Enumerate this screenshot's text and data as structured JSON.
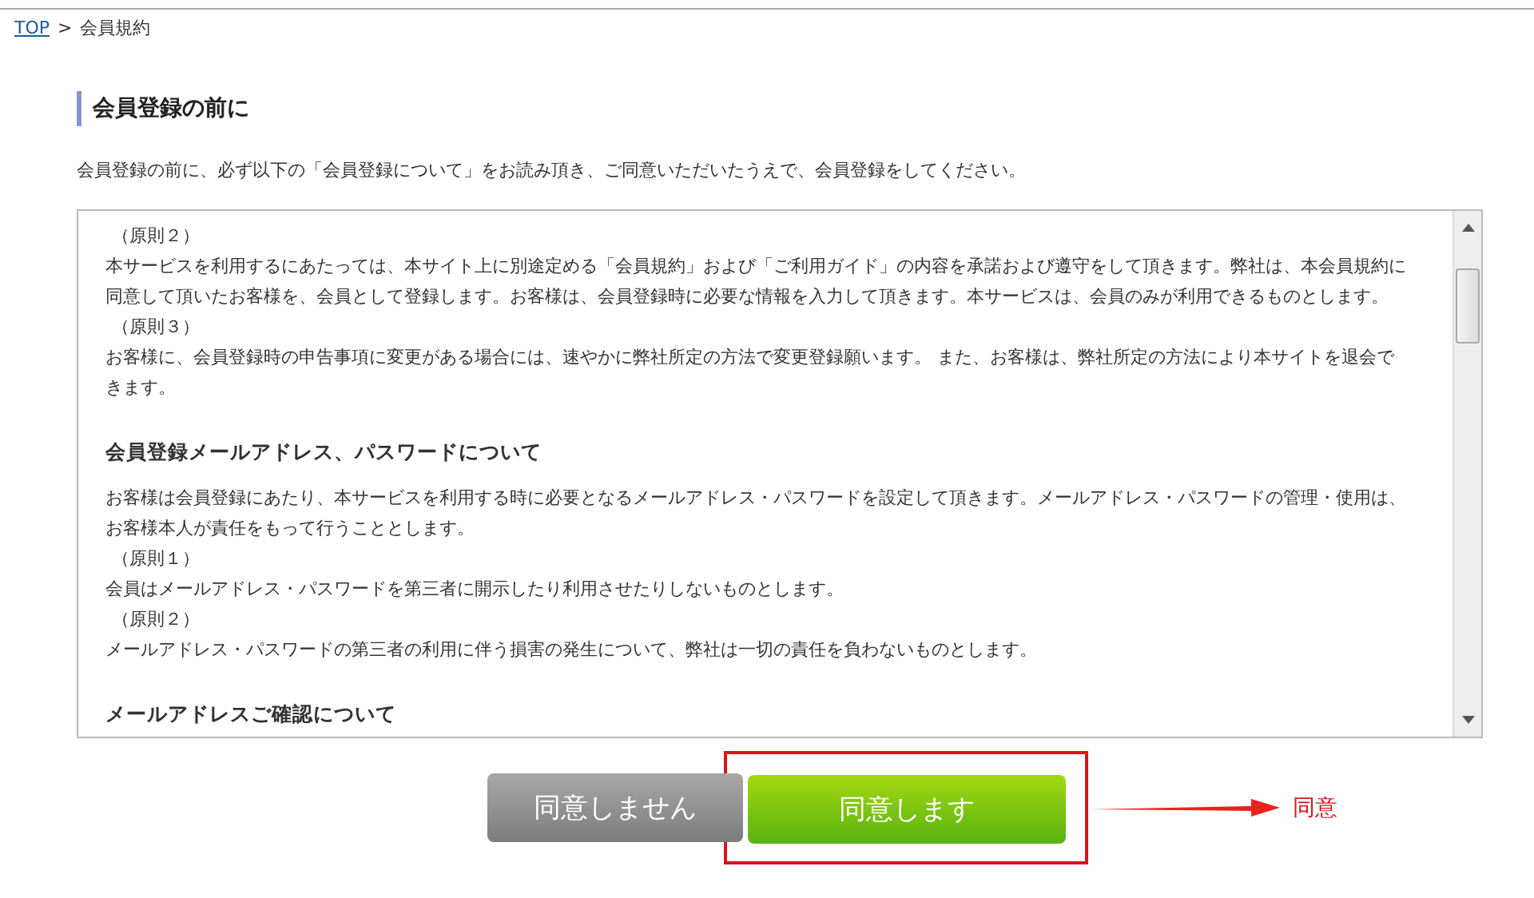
{
  "breadcrumb": [
    {
      "label": "TOP",
      "link": true
    },
    {
      "label": ">",
      "link": false
    },
    {
      "label": "会員規約",
      "link": false
    }
  ],
  "heading": "会員登録の前に",
  "intro": "会員登録の前に、必ず以下の「会員登録について」をお読み頂き、ご同意いただいたうえで、会員登録をしてください。",
  "terms": [
    {
      "kind": "label",
      "text": "（原則２）"
    },
    {
      "kind": "para",
      "text": "本サービスを利用するにあたっては、本サイト上に別途定める「会員規約」および「ご利用ガイド」の内容を承諾および遵守をして頂きます。弊社は、本会員規約に同意して頂いたお客様を、会員として登録します。お客様は、会員登録時に必要な情報を入力して頂きます。本サービスは、会員のみが利用できるものとします。"
    },
    {
      "kind": "label",
      "text": "（原則３）"
    },
    {
      "kind": "para",
      "text": "お客様に、会員登録時の申告事項に変更がある場合には、速やかに弊社所定の方法で変更登録願います。 また、お客様は、弊社所定の方法により本サイトを退会できます。"
    },
    {
      "kind": "heading",
      "text": "会員登録メールアドレス、パスワードについて"
    },
    {
      "kind": "para",
      "text": "お客様は会員登録にあたり、本サービスを利用する時に必要となるメールアドレス・パスワードを設定して頂きます。メールアドレス・パスワードの管理・使用は、お客様本人が責任をもって行うこととします。"
    },
    {
      "kind": "label",
      "text": "（原則１）"
    },
    {
      "kind": "para",
      "text": "会員はメールアドレス・パスワードを第三者に開示したり利用させたりしないものとします。"
    },
    {
      "kind": "label",
      "text": "（原則２）"
    },
    {
      "kind": "para",
      "text": "メールアドレス・パスワードの第三者の利用に伴う損害の発生について、弊社は一切の責任を負わないものとします。"
    },
    {
      "kind": "heading",
      "text": "メールアドレスご確認について"
    }
  ],
  "buttons": [
    {
      "kind": "decline",
      "label": "同意しません",
      "highlighted": false
    },
    {
      "kind": "agree",
      "label": "同意します",
      "highlighted": true
    }
  ],
  "annotation": {
    "text": "同意"
  }
}
